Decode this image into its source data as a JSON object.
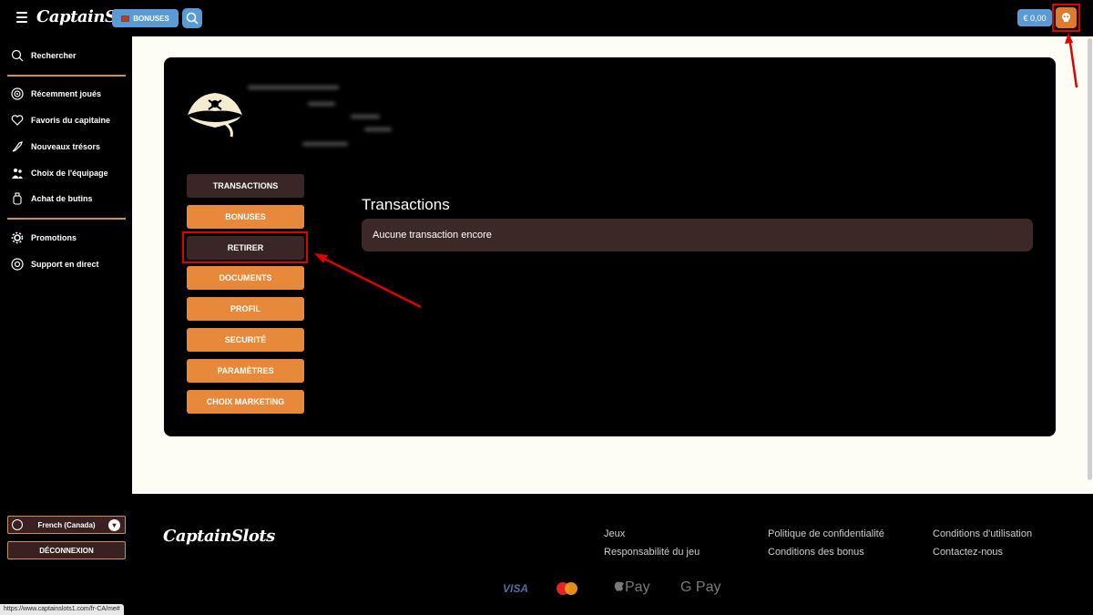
{
  "header": {
    "logo": "CaptainSlots",
    "bonus_label": "BONUSES",
    "balance": "€ 0,00"
  },
  "sidebar": {
    "items": [
      {
        "label": "Rechercher",
        "icon": "search-icon"
      },
      {
        "label": "Récemment joués",
        "icon": "target-icon"
      },
      {
        "label": "Favoris du capitaine",
        "icon": "heart-icon"
      },
      {
        "label": "Nouveaux trésors",
        "icon": "rocket-icon"
      },
      {
        "label": "Choix de l'équipage",
        "icon": "crew-icon"
      },
      {
        "label": "Achat de butins",
        "icon": "bottle-icon"
      },
      {
        "label": "Promotions",
        "icon": "gear-icon"
      },
      {
        "label": "Support en direct",
        "icon": "lifebuoy-icon"
      }
    ],
    "language": "French (Canada)",
    "logout_label": "DÉCONNEXION"
  },
  "status_url": "https://www.captainslots1.com/fr-CA/me#",
  "account_menu": [
    {
      "label": "TRANSACTIONS",
      "active": true
    },
    {
      "label": "BONUSES",
      "active": false
    },
    {
      "label": "RETIRER",
      "active": true
    },
    {
      "label": "DOCUMENTS",
      "active": false
    },
    {
      "label": "PROFIL",
      "active": false
    },
    {
      "label": "SECURITÉ",
      "active": false
    },
    {
      "label": "PARAMÈTRES",
      "active": false
    },
    {
      "label": "CHOIX MARKETING",
      "active": false
    }
  ],
  "transactions": {
    "title": "Transactions",
    "empty_message": "Aucune transaction encore"
  },
  "footer": {
    "logo": "CaptainSlots",
    "links": [
      "Jeux",
      "Responsabilité du jeu",
      "Politique de confidentialité",
      "Conditions des bonus",
      "Conditions d'utilisation",
      "Contactez-nous"
    ],
    "payments": [
      "VISA",
      "Pay",
      "G Pay"
    ]
  },
  "colors": {
    "accent_orange": "#e8883a",
    "active_dark": "#3a2626",
    "blue_button": "#5b9bd5",
    "annotation_red": "#e00000"
  }
}
